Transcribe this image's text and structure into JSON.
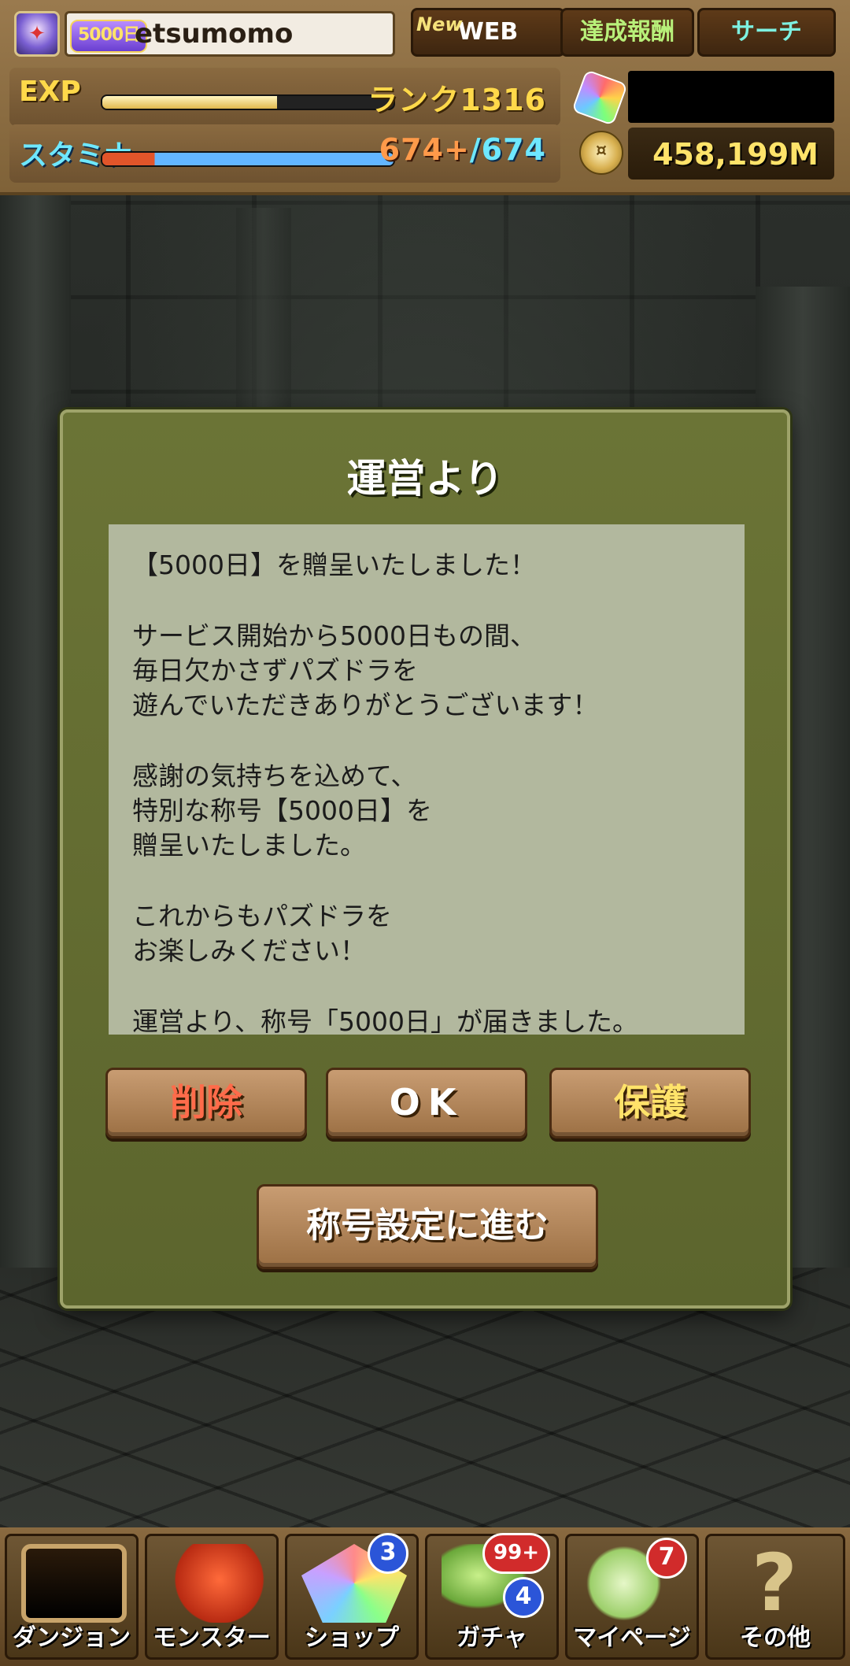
{
  "header": {
    "badge": "5000日",
    "username": "etsumomo",
    "web_new": "New",
    "web_label": "WEB",
    "achievements_label": "達成報酬",
    "search_label": "サーチ"
  },
  "status": {
    "exp_label": "EXP",
    "rank": "ランク1316",
    "exp_fraction": 0.6,
    "stamina_label": "スタミナ",
    "stamina_current": "674+",
    "stamina_max": "/674",
    "coins": "458,199M"
  },
  "dialog": {
    "title": "運営より",
    "message": [
      "【5000日】を贈呈いたしました！",
      "サービス開始から5000日もの間、\n毎日欠かさずパズドラを\n遊んでいただきありがとうございます！",
      "感謝の気持ちを込めて、\n特別な称号【5000日】を\n贈呈いたしました。",
      "これからもパズドラを\nお楽しみください！",
      "運営より、称号「5000日」が届きました。"
    ],
    "delete_label": "削除",
    "ok_label": "OK",
    "protect_label": "保護",
    "title_settings_label": "称号設定に進む"
  },
  "nav": {
    "dungeon": "ダンジョン",
    "monster": "モンスター",
    "shop": "ショップ",
    "shop_badge": "3",
    "gacha": "ガチャ",
    "gacha_badge_top": "99+",
    "gacha_badge_bottom": "4",
    "mypage": "マイページ",
    "mypage_badge": "7",
    "other": "その他"
  },
  "colors": {
    "dialog_bg": "#5c652d",
    "message_bg": "#b2b89e",
    "button_bg": "#b48658",
    "delete_text": "#ff6b4a",
    "protect_text": "#ffe36a"
  }
}
